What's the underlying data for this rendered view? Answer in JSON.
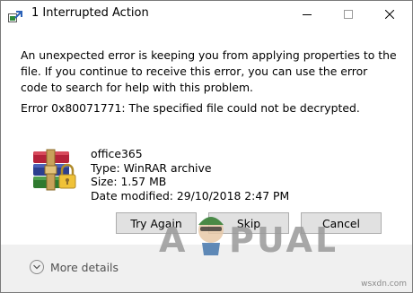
{
  "window": {
    "title": "1 Interrupted Action"
  },
  "dialog": {
    "message": "An unexpected error is keeping you from applying properties to the file. If you continue to receive this error, you can use the error code to search for help with this problem.",
    "error": "Error 0x80071771: The specified file could not be decrypted.",
    "file": {
      "name": "office365",
      "type": "Type: WinRAR archive",
      "size": "Size: 1.57 MB",
      "modified": "Date modified: 29/10/2018 2:47 PM",
      "icon": "winrar-archive-icon"
    },
    "buttons": {
      "try_again": "Try Again",
      "skip": "Skip",
      "cancel": "Cancel"
    },
    "more_details": "More details"
  },
  "watermark": {
    "left": "A",
    "right": "PUALS"
  },
  "site_url": "wsxdn.com",
  "colors": {
    "footer_bg": "#f0f0f0",
    "button_bg": "#e1e1e1",
    "button_border": "#adadad",
    "watermark": "#9a9a9a"
  }
}
